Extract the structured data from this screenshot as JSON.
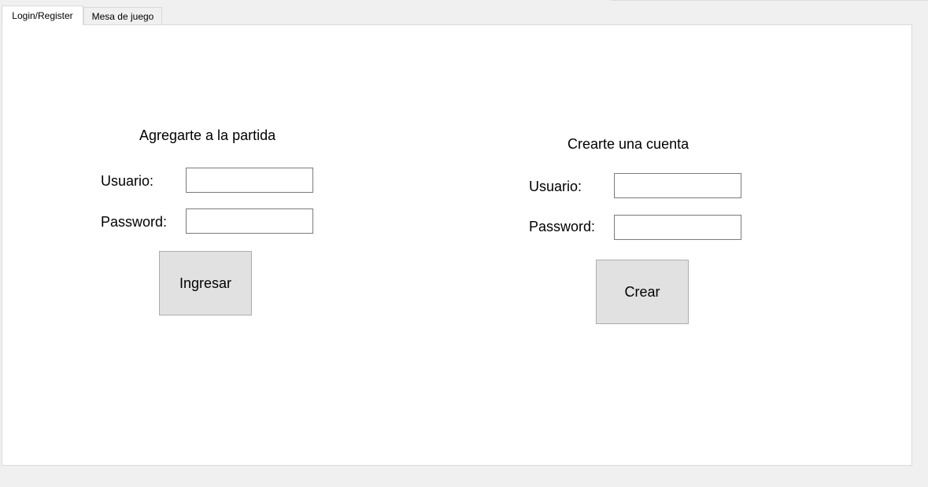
{
  "tabs": [
    {
      "label": "Login/Register"
    },
    {
      "label": "Mesa de juego"
    }
  ],
  "login": {
    "heading": "Agregarte a la partida",
    "usuario_label": "Usuario:",
    "password_label": "Password:",
    "usuario_value": "",
    "password_value": "",
    "button_label": "Ingresar"
  },
  "register": {
    "heading": "Crearte una cuenta",
    "usuario_label": "Usuario:",
    "password_label": "Password:",
    "usuario_value": "",
    "password_value": "",
    "button_label": "Crear"
  }
}
